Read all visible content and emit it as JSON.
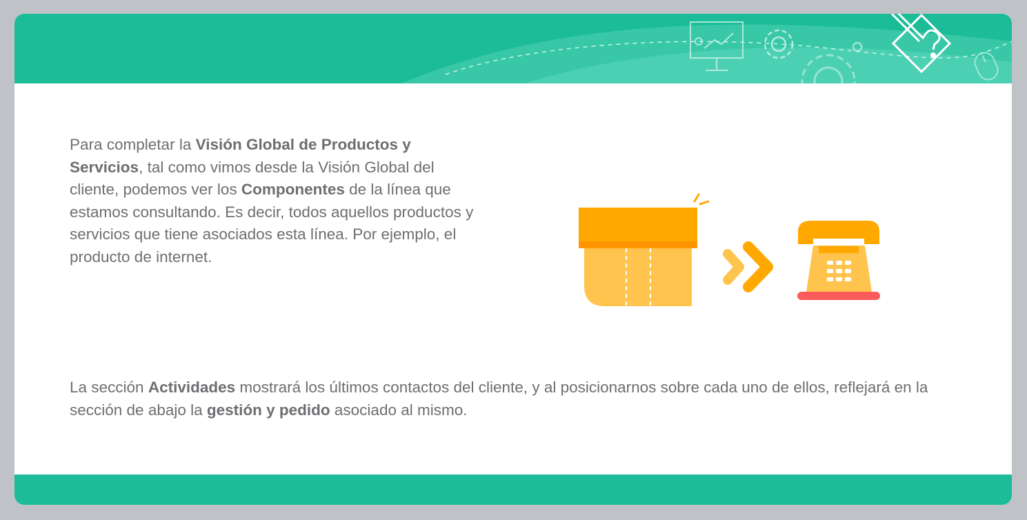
{
  "intro": {
    "t1": "Para completar la ",
    "b1": "Visión Global de Productos y Servicios",
    "t2": ", tal como vimos desde la Visión Global del cliente, podemos ver los ",
    "b2": "Componentes",
    "t3": " de la línea que estamos consultando. Es decir, todos aquellos productos y servicios que tiene asociados esta línea. Por ejemplo, el producto de internet."
  },
  "activities": {
    "t1": "La sección ",
    "b1": "Actividades",
    "t2": " mostrará los últimos contactos del cliente, y al posicionarnos sobre cada uno de ellos, reflejará en la sección de abajo la ",
    "b2": "gestión y pedido",
    "t3": " asociado al mismo."
  },
  "illustration": {
    "left_icon": "box-icon",
    "middle_icon": "double-chevron-right-icon",
    "right_icon": "telephone-icon"
  },
  "header_icons": [
    "presentation-board-icon",
    "gear-icon",
    "settings-gear-icon",
    "pencil-question-icon",
    "mouse-icon"
  ],
  "colors": {
    "accent": "#1dbc98",
    "text": "#6d6e71",
    "orange": "#ffa800",
    "yellow": "#ffc44d",
    "red": "#fa5c5c"
  }
}
